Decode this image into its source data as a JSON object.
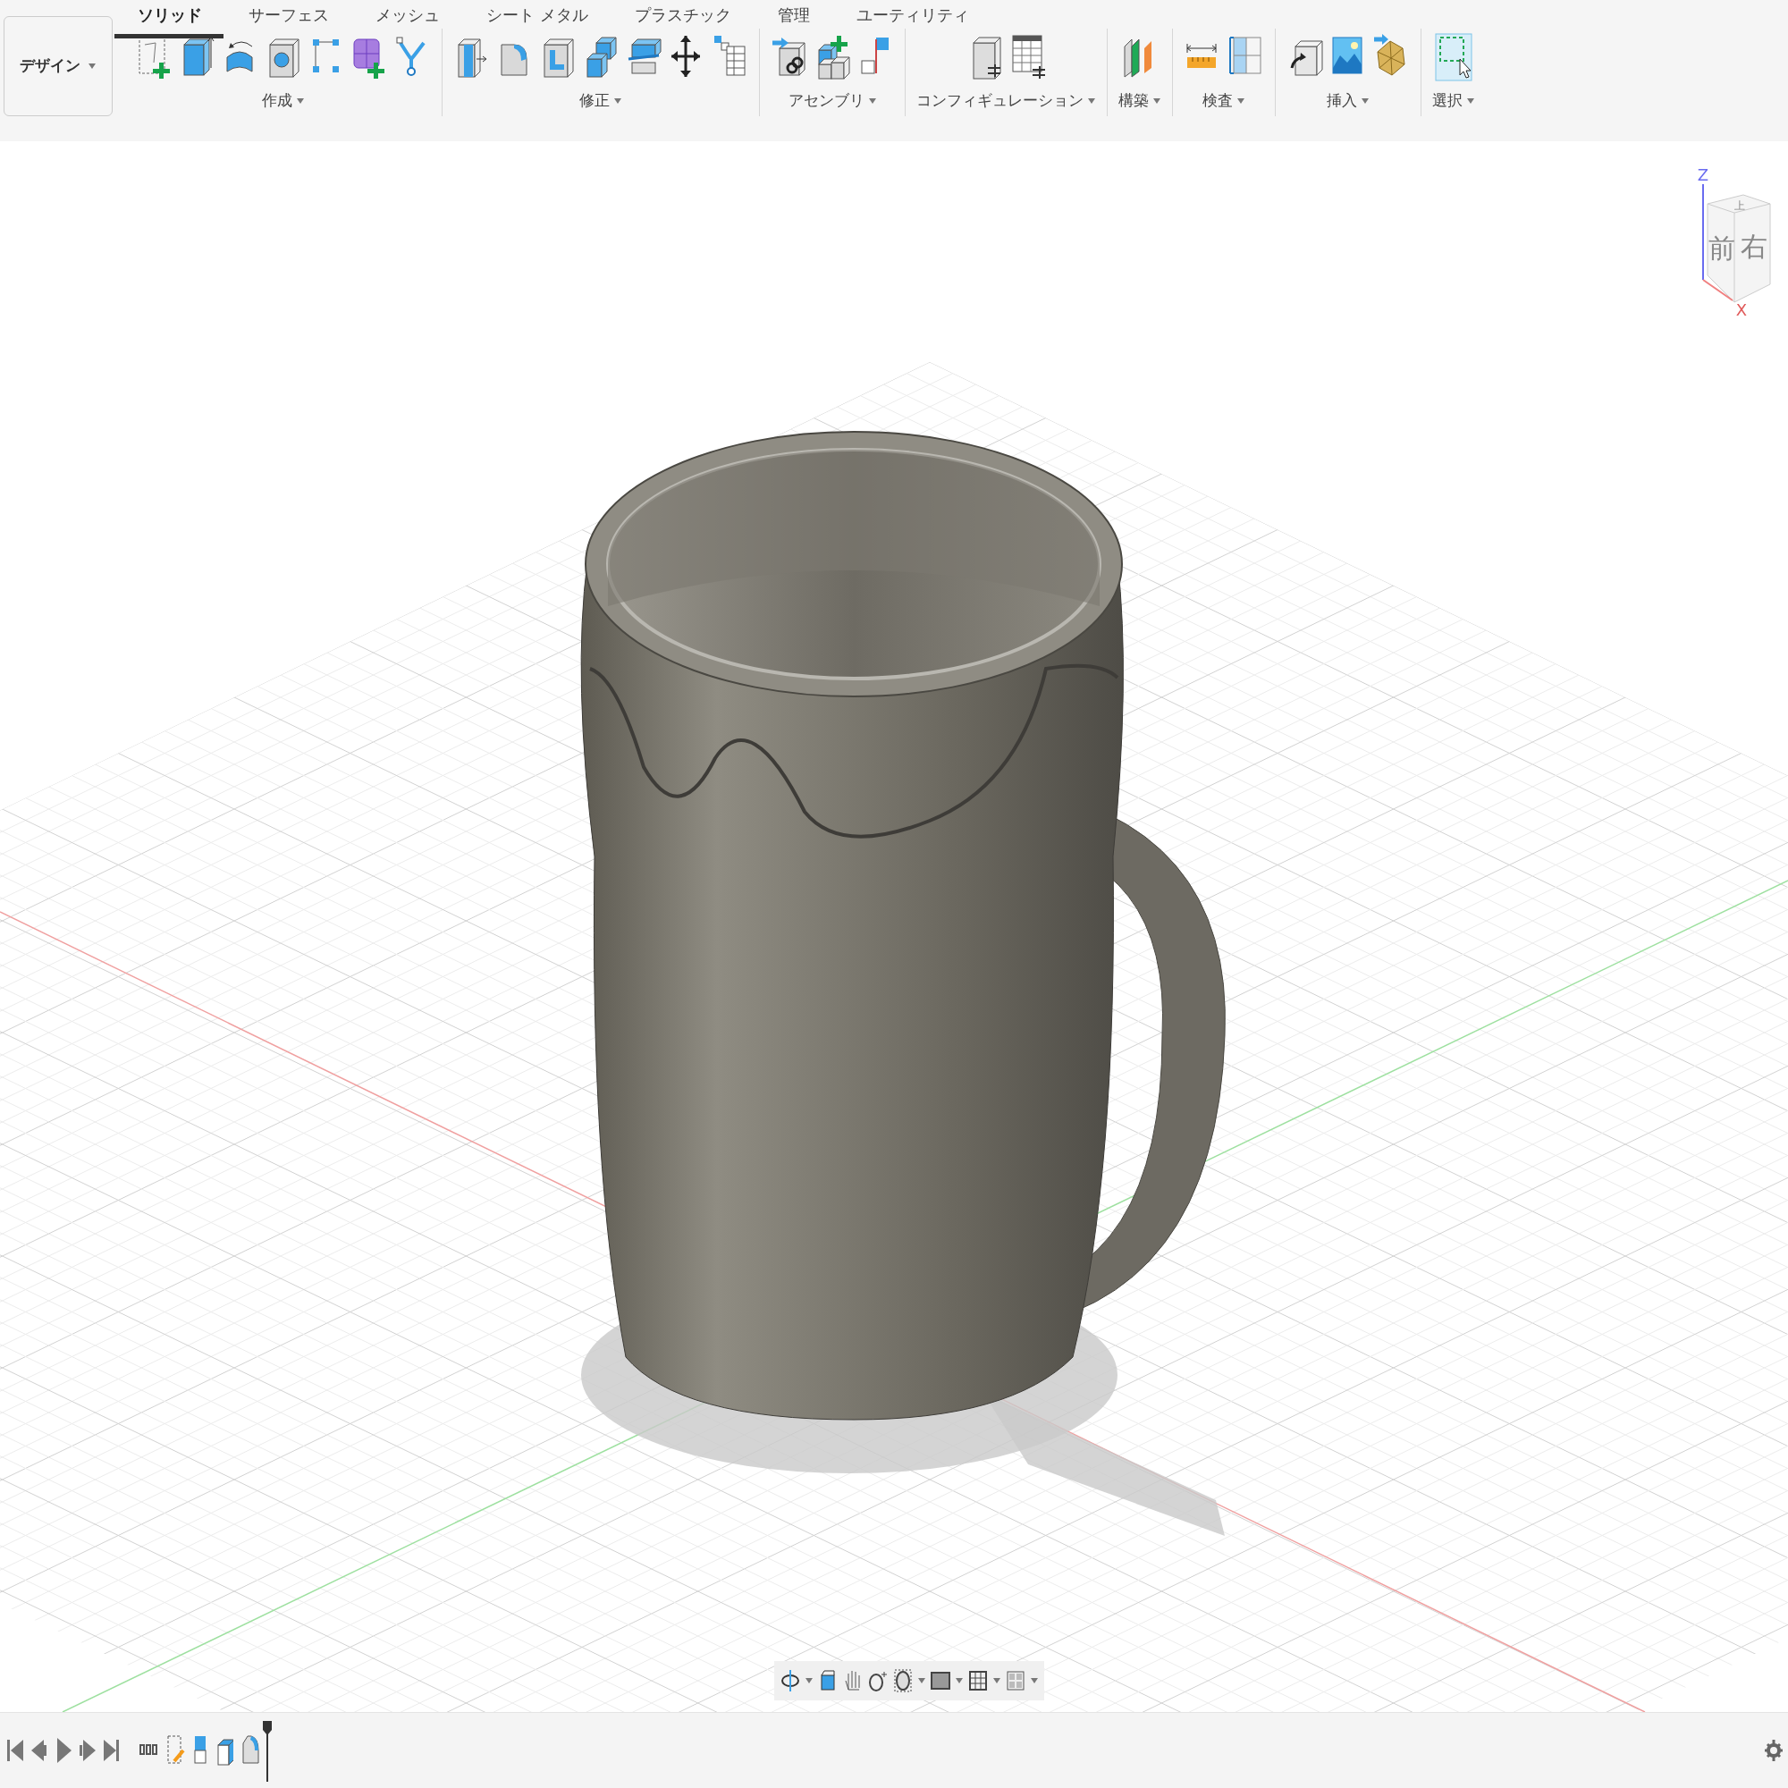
{
  "design_button": {
    "label": "デザイン"
  },
  "tabs": [
    {
      "label": "ソリッド",
      "selected": true
    },
    {
      "label": "サーフェス",
      "selected": false
    },
    {
      "label": "メッシュ",
      "selected": false
    },
    {
      "label": "シート メタル",
      "selected": false
    },
    {
      "label": "プラスチック",
      "selected": false
    },
    {
      "label": "管理",
      "selected": false
    },
    {
      "label": "ユーティリティ",
      "selected": false
    }
  ],
  "tool_groups": [
    {
      "label": "作成"
    },
    {
      "label": "修正"
    },
    {
      "label": "アセンブリ"
    },
    {
      "label": "コンフィギュレーション"
    },
    {
      "label": "構築"
    },
    {
      "label": "検査"
    },
    {
      "label": "挿入"
    },
    {
      "label": "選択"
    }
  ],
  "view_cube": {
    "faces": [
      "前",
      "右",
      "上"
    ],
    "axes": [
      "Z",
      "X"
    ]
  }
}
